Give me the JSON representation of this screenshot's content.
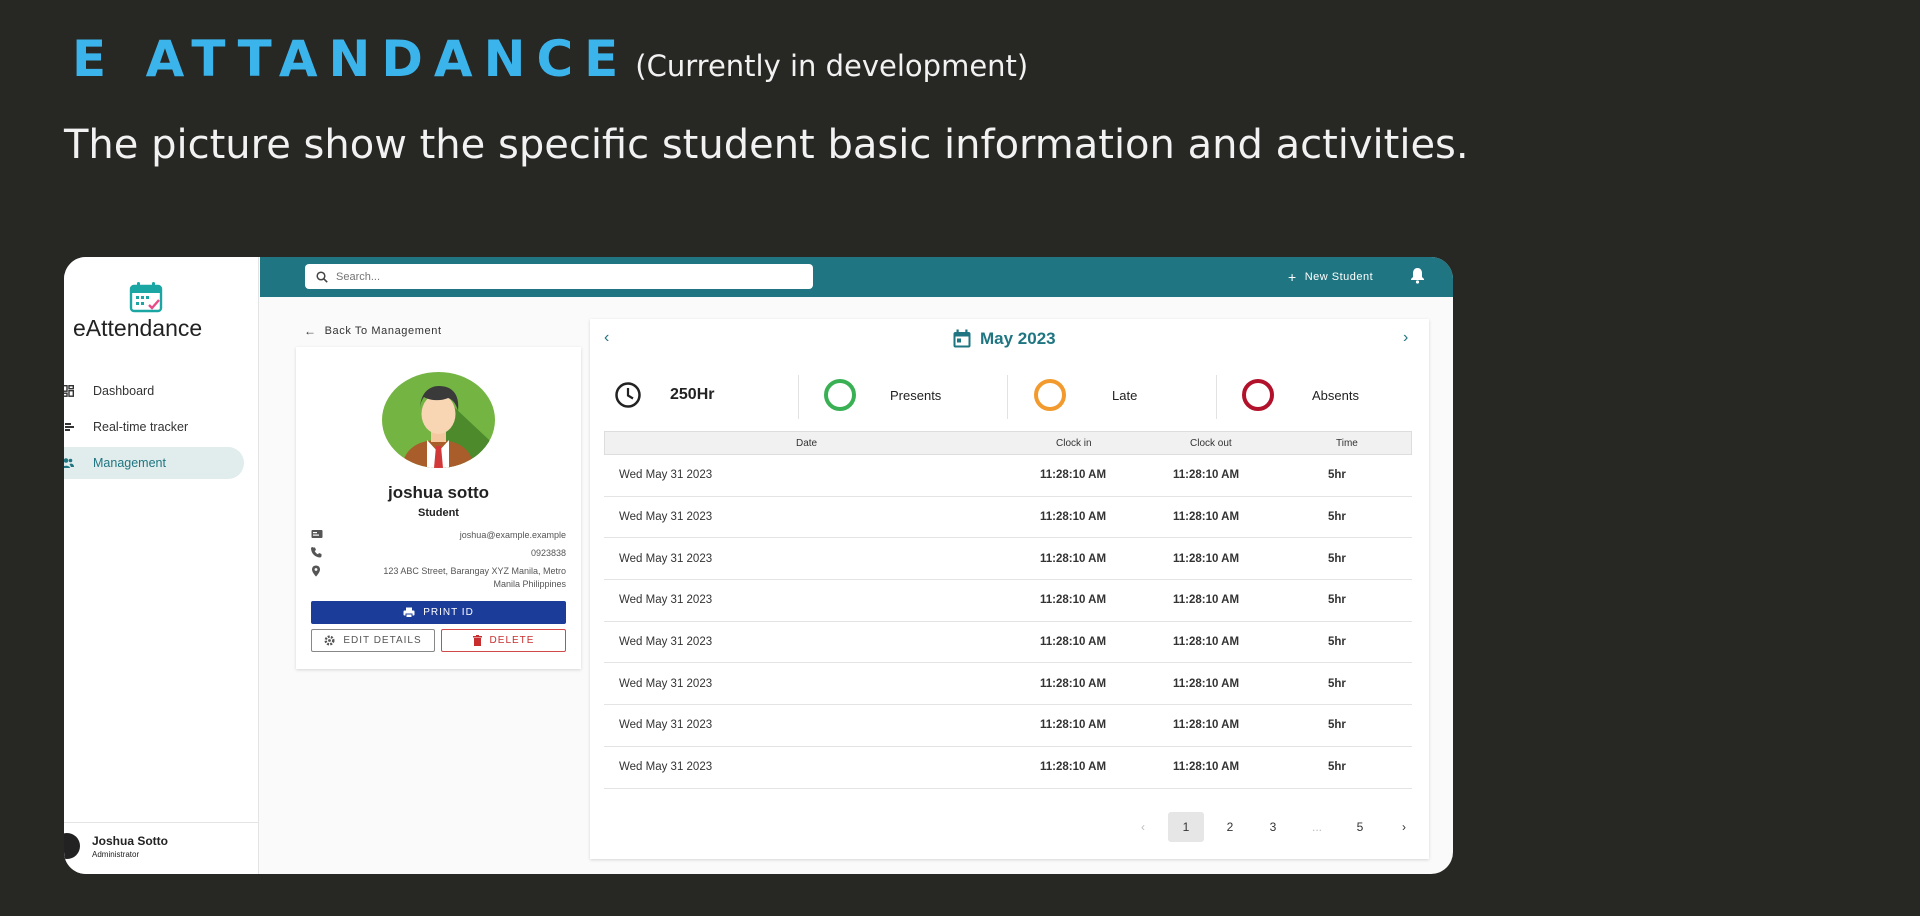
{
  "hero": {
    "title": "E ATTANDANCE",
    "subtitle_tag": "(Currently in development)",
    "description": "The picture show the specific student basic information and activities."
  },
  "sidebar": {
    "brand": "eAttendance",
    "items": [
      {
        "label": "Dashboard",
        "icon": "dashboard-icon"
      },
      {
        "label": "Real-time tracker",
        "icon": "tracker-icon"
      },
      {
        "label": "Management",
        "icon": "people-icon",
        "active": true
      }
    ],
    "user": {
      "name": "Joshua Sotto",
      "role": "Administrator"
    }
  },
  "topbar": {
    "search_placeholder": "Search...",
    "new_student": "New Student"
  },
  "back": {
    "label": "Back To Management"
  },
  "profile": {
    "name": "joshua sotto",
    "role": "Student",
    "email": "joshua@example.example",
    "phone": "0923838",
    "address_line1": "123 ABC Street, Barangay XYZ Manila, Metro",
    "address_line2": "Manila Philippines",
    "print_label": "PRINT ID",
    "edit_label": "EDIT DETAILS",
    "delete_label": "DELETE"
  },
  "calendar": {
    "month": "May 2023"
  },
  "stats": {
    "hours": "250Hr",
    "presents": "Presents",
    "late": "Late",
    "absents": "Absents"
  },
  "colors": {
    "accent": "#1f7581",
    "title_blue": "#3bb4ec",
    "present": "#3ab054",
    "late": "#f29a2e",
    "absent": "#b1112a",
    "print_button": "#1c3c9a"
  },
  "table": {
    "headers": [
      "Date",
      "Clock in",
      "Clock out",
      "Time"
    ],
    "rows": [
      [
        "Wed May 31 2023",
        "11:28:10 AM",
        "11:28:10 AM",
        "5hr"
      ],
      [
        "Wed May 31 2023",
        "11:28:10 AM",
        "11:28:10 AM",
        "5hr"
      ],
      [
        "Wed May 31 2023",
        "11:28:10 AM",
        "11:28:10 AM",
        "5hr"
      ],
      [
        "Wed May 31 2023",
        "11:28:10 AM",
        "11:28:10 AM",
        "5hr"
      ],
      [
        "Wed May 31 2023",
        "11:28:10 AM",
        "11:28:10 AM",
        "5hr"
      ],
      [
        "Wed May 31 2023",
        "11:28:10 AM",
        "11:28:10 AM",
        "5hr"
      ],
      [
        "Wed May 31 2023",
        "11:28:10 AM",
        "11:28:10 AM",
        "5hr"
      ],
      [
        "Wed May 31 2023",
        "11:28:10 AM",
        "11:28:10 AM",
        "5hr"
      ]
    ]
  },
  "pagination": {
    "prev": "‹",
    "pages": [
      "1",
      "2",
      "3",
      "...",
      "5"
    ],
    "current": "1",
    "next": "›"
  }
}
